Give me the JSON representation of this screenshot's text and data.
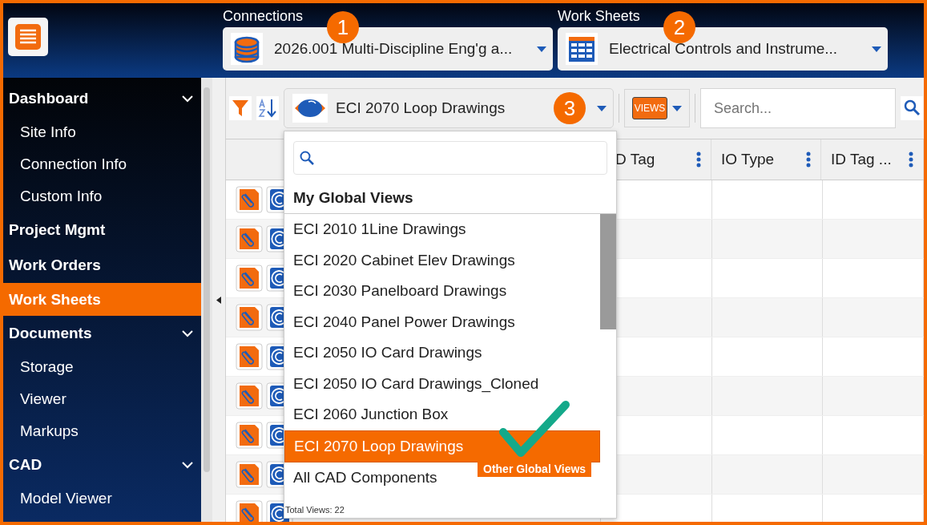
{
  "header": {
    "connections": {
      "label": "Connections",
      "value": "2026.001 Multi-Discipline Eng'g a...",
      "badge": "1"
    },
    "work_sheets": {
      "label": "Work Sheets",
      "value": "Electrical Controls and Instrume...",
      "badge": "2"
    }
  },
  "sidebar": {
    "items": [
      {
        "label": "Dashboard",
        "expanded": true,
        "selected": false,
        "children": [
          {
            "label": "Site Info"
          },
          {
            "label": "Connection Info"
          },
          {
            "label": "Custom Info"
          }
        ]
      },
      {
        "label": "Project Mgmt",
        "selected": false
      },
      {
        "label": "Work Orders",
        "selected": false
      },
      {
        "label": "Work Sheets",
        "selected": true
      },
      {
        "label": "Documents",
        "expanded": true,
        "selected": false,
        "children": [
          {
            "label": "Storage"
          },
          {
            "label": "Viewer"
          },
          {
            "label": "Markups"
          }
        ]
      },
      {
        "label": "CAD",
        "expanded": true,
        "selected": false,
        "children": [
          {
            "label": "Model Viewer"
          }
        ]
      }
    ]
  },
  "toolbar": {
    "view_select": {
      "value": "ECI 2070 Loop Drawings",
      "badge": "3"
    },
    "views_button": {
      "label": "VIEWS"
    },
    "search": {
      "placeholder": "Search..."
    }
  },
  "table": {
    "columns": [
      "D Tag",
      "IO Type",
      "ID Tag ..."
    ],
    "rows": [
      {
        "kind": "attachment"
      },
      {
        "kind": "attachment"
      },
      {
        "kind": "attachment"
      },
      {
        "kind": "attachment"
      },
      {
        "kind": "attachment"
      },
      {
        "kind": "attachment"
      },
      {
        "kind": "attachment"
      },
      {
        "kind": "attachment"
      },
      {
        "kind": "attachment"
      }
    ]
  },
  "views_dropdown": {
    "heading": "My Global Views",
    "items": [
      {
        "label": "ECI 2010 1Line Drawings",
        "selected": false
      },
      {
        "label": "ECI 2020 Cabinet Elev Drawings",
        "selected": false
      },
      {
        "label": "ECI 2030 Panelboard Drawings",
        "selected": false
      },
      {
        "label": "ECI 2040 Panel Power Drawings",
        "selected": false
      },
      {
        "label": "ECI 2050 IO Card Drawings",
        "selected": false
      },
      {
        "label": "ECI 2050 IO Card Drawings_Cloned",
        "selected": false
      },
      {
        "label": "ECI 2060 Junction Box",
        "selected": false
      },
      {
        "label": "ECI 2070 Loop Drawings",
        "selected": true
      },
      {
        "label": "All CAD Components",
        "selected": false
      }
    ],
    "callout": "Other Global Views",
    "footer": "Total Views: 22"
  }
}
